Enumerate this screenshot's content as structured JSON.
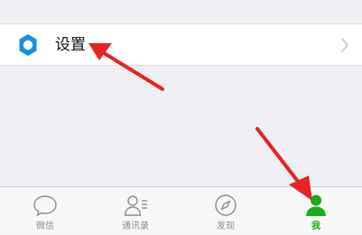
{
  "settings_row": {
    "label": "设置",
    "icon": "gear-icon",
    "chevron": "chevron-right-icon"
  },
  "tabbar": {
    "tabs": [
      {
        "label": "微信",
        "icon": "chat-bubble-icon",
        "active": false
      },
      {
        "label": "通讯录",
        "icon": "contacts-icon",
        "active": false
      },
      {
        "label": "发现",
        "icon": "compass-icon",
        "active": false
      },
      {
        "label": "我",
        "icon": "person-icon",
        "active": true
      }
    ]
  },
  "colors": {
    "accent_green": "#1aad19",
    "icon_blue": "#1a8ee6",
    "arrow_red": "#e82323",
    "inactive_gray": "#8c8c8c",
    "background": "#efeff4"
  },
  "annotations": [
    {
      "type": "arrow",
      "points_to": "settings-row",
      "color": "#e82323"
    },
    {
      "type": "arrow",
      "points_to": "tab-me",
      "color": "#e82323"
    }
  ]
}
